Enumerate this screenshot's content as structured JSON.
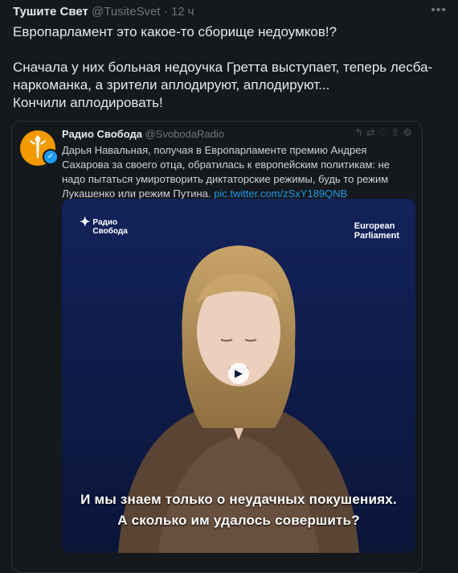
{
  "tweet": {
    "author_name": "Тушите Свет",
    "author_handle": "@TusiteSvet",
    "separator": "·",
    "time": "12 ч",
    "more_icon": "more-icon",
    "text_lines": [
      "Европарламент это какое-то сборище недоумков!?",
      "",
      "Сначала у них больная недоучка Гретта выступает, теперь лесба-",
      "наркоманка, а зрители аплодируют, аплодируют...",
      "Кончили аплодировать!"
    ]
  },
  "quoted": {
    "name": "Радио Свобода",
    "handle": "@SvobodaRadio",
    "text": "Дарья Навальная, получая в Европарламенте премию Андрея Сахарова за своего отца, обратилась к европейским политикам: не надо пытаться умиротворить диктаторские режимы, будь то режим Лукашенко или режим Путина.",
    "link": "pic.twitter.com/zSxY189QNB",
    "actions": [
      "reply-icon",
      "retweet-icon",
      "like-icon",
      "share-icon",
      "settings-icon"
    ],
    "video": {
      "logo_line1": "Радио",
      "logo_line2": "Свобода",
      "ep_line1": "European",
      "ep_line2": "Parliament",
      "subtitle1": "И мы знаем только о неудачных покушениях.",
      "subtitle2": "А сколько им удалось совершить?"
    }
  },
  "colors": {
    "background": "#15181c",
    "text": "#e7e9ea",
    "muted": "#71767b",
    "link": "#1d9bf0",
    "avatar": "#f29a00",
    "video_bg": "#0d1b44"
  }
}
